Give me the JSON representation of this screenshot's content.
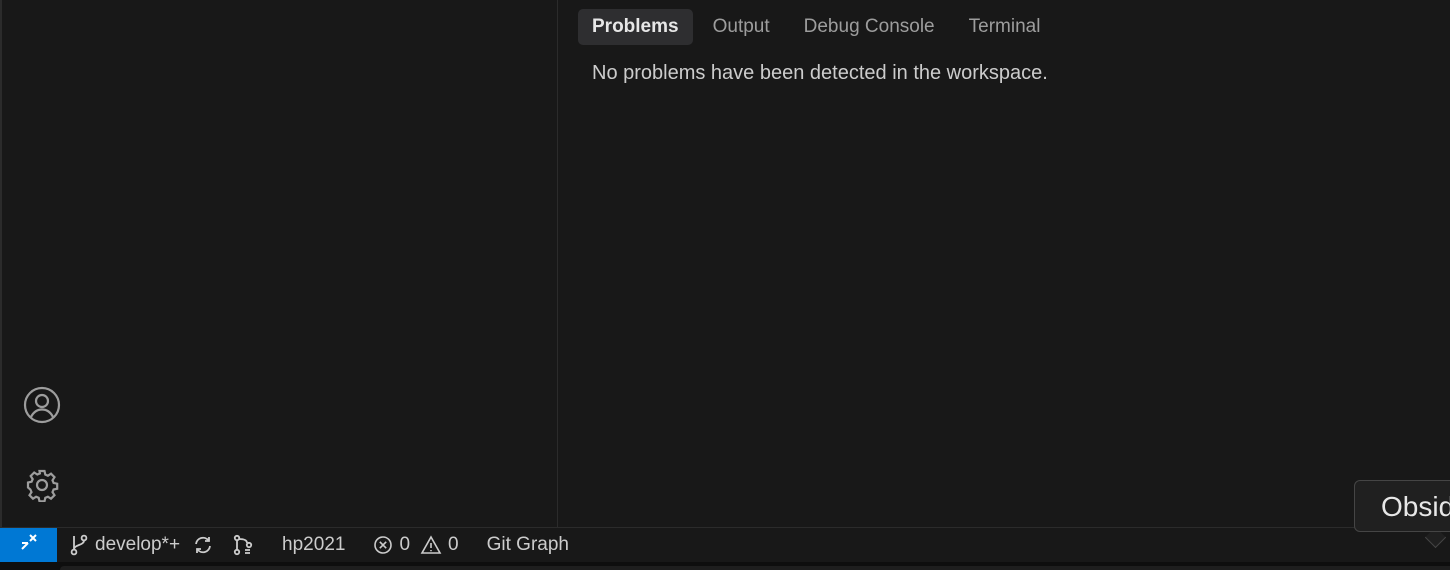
{
  "panel": {
    "tabs": [
      {
        "label": "Problems",
        "active": true
      },
      {
        "label": "Output",
        "active": false
      },
      {
        "label": "Debug Console",
        "active": false
      },
      {
        "label": "Terminal",
        "active": false
      }
    ],
    "message": "No problems have been detected in the workspace."
  },
  "activity": {
    "accounts_icon": "account-icon",
    "manage_icon": "gear-icon"
  },
  "status_bar": {
    "remote_icon": "remote-icon",
    "branch": "develop*+",
    "branch_icon": "git-branch-icon",
    "sync_icon": "sync-icon",
    "git_graph_icon": "git-compare-icon",
    "profile": "hp2021",
    "errors": "0",
    "warnings": "0",
    "git_graph": "Git Graph"
  },
  "tooltip": {
    "text": "Obsidian"
  },
  "colors": {
    "background": "#181818",
    "remote_accent": "#0078d4",
    "active_tab_bg": "#2e2e30"
  }
}
